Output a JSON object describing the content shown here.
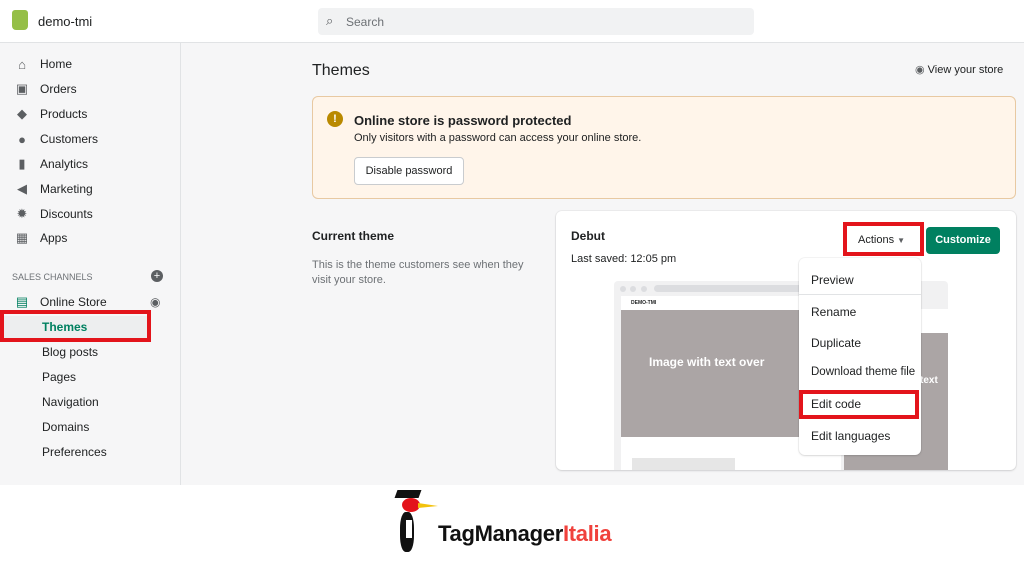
{
  "topbar": {
    "store_name": "demo-tmi",
    "search_placeholder": "Search"
  },
  "sidebar": {
    "items": [
      {
        "label": "Home",
        "icon": "home-icon"
      },
      {
        "label": "Orders",
        "icon": "orders-icon"
      },
      {
        "label": "Products",
        "icon": "tag-icon"
      },
      {
        "label": "Customers",
        "icon": "person-icon"
      },
      {
        "label": "Analytics",
        "icon": "bar-chart-icon"
      },
      {
        "label": "Marketing",
        "icon": "megaphone-icon"
      },
      {
        "label": "Discounts",
        "icon": "discount-icon"
      },
      {
        "label": "Apps",
        "icon": "apps-icon"
      }
    ],
    "sales_channels_label": "SALES CHANNELS",
    "online_store": "Online Store",
    "subitems": [
      "Themes",
      "Blog posts",
      "Pages",
      "Navigation",
      "Domains",
      "Preferences"
    ]
  },
  "main": {
    "title": "Themes",
    "view_store": "View your store",
    "banner": {
      "title": "Online store is password protected",
      "text": "Only visitors with a password can access your online store.",
      "button": "Disable password"
    },
    "current_theme": {
      "heading": "Current theme",
      "description": "This is the theme customers see when they visit your store."
    },
    "theme_card": {
      "name": "Debut",
      "last_saved": "Last saved: 12:05 pm",
      "actions": "Actions",
      "customize": "Customize",
      "preview_brand": "DEMO-TMI",
      "preview_heading": "Image with text over",
      "preview_mobile_heading": "text"
    },
    "actions_menu": [
      "Preview",
      "Rename",
      "Duplicate",
      "Download theme file",
      "Edit code",
      "Edit languages"
    ]
  },
  "footer_logo": {
    "text_black": "TagManager",
    "text_red": "Italia"
  },
  "colors": {
    "accent": "#008060",
    "highlight": "#e3141b",
    "banner_bg": "#fff5ea",
    "brand_red": "#f0413c"
  }
}
